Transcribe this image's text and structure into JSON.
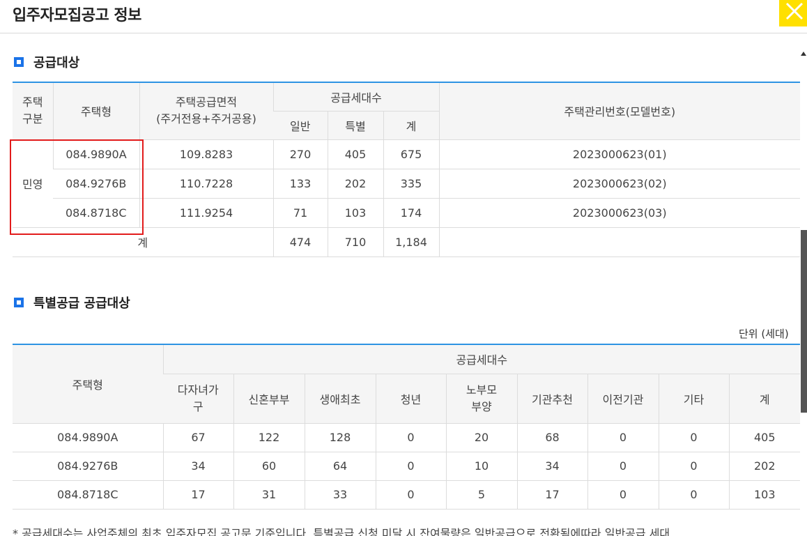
{
  "header": {
    "title": "입주자모집공고 정보"
  },
  "supply": {
    "title": "공급대상",
    "headers": {
      "type_div": "주택\n구분",
      "house_type": "주택형",
      "area": "주택공급면적\n(주거전용+주거공용)",
      "units": "공급세대수",
      "general": "일반",
      "special": "특별",
      "total": "계",
      "mgmt_no": "주택관리번호(모델번호)"
    },
    "div_label": "민영",
    "rows": [
      {
        "type": "084.9890A",
        "area": "109.8283",
        "general": "270",
        "special": "405",
        "total": "675",
        "mgmt": "2023000623(01)"
      },
      {
        "type": "084.9276B",
        "area": "110.7228",
        "general": "133",
        "special": "202",
        "total": "335",
        "mgmt": "2023000623(02)"
      },
      {
        "type": "084.8718C",
        "area": "111.9254",
        "general": "71",
        "special": "103",
        "total": "174",
        "mgmt": "2023000623(03)"
      }
    ],
    "sum": {
      "label": "계",
      "general": "474",
      "special": "710",
      "total": "1,184"
    }
  },
  "special": {
    "title": "특별공급 공급대상",
    "unit": "단위 (세대)",
    "headers": {
      "house_type": "주택형",
      "units": "공급세대수",
      "cols": [
        "다자녀가\n구",
        "신혼부부",
        "생애최초",
        "청년",
        "노부모\n부양",
        "기관추천",
        "이전기관",
        "기타",
        "계"
      ]
    },
    "rows": [
      {
        "type": "084.9890A",
        "values": [
          "67",
          "122",
          "128",
          "0",
          "20",
          "68",
          "0",
          "0",
          "405"
        ]
      },
      {
        "type": "084.9276B",
        "values": [
          "34",
          "60",
          "64",
          "0",
          "10",
          "34",
          "0",
          "0",
          "202"
        ]
      },
      {
        "type": "084.8718C",
        "values": [
          "17",
          "31",
          "33",
          "0",
          "5",
          "17",
          "0",
          "0",
          "103"
        ]
      }
    ]
  },
  "footnote": "* 공급세대수는 사업주체의 최초 입주자모집 공고문 기준입니다. 특별공급 신청 미달 시 잔여물량은 일반공급으로 전환됨에따라 일반공급 세대",
  "colors": {
    "accent": "#2d93e3",
    "close_bg": "#ffe000",
    "highlight": "#e21b1b",
    "icon": "#1a73e8"
  }
}
